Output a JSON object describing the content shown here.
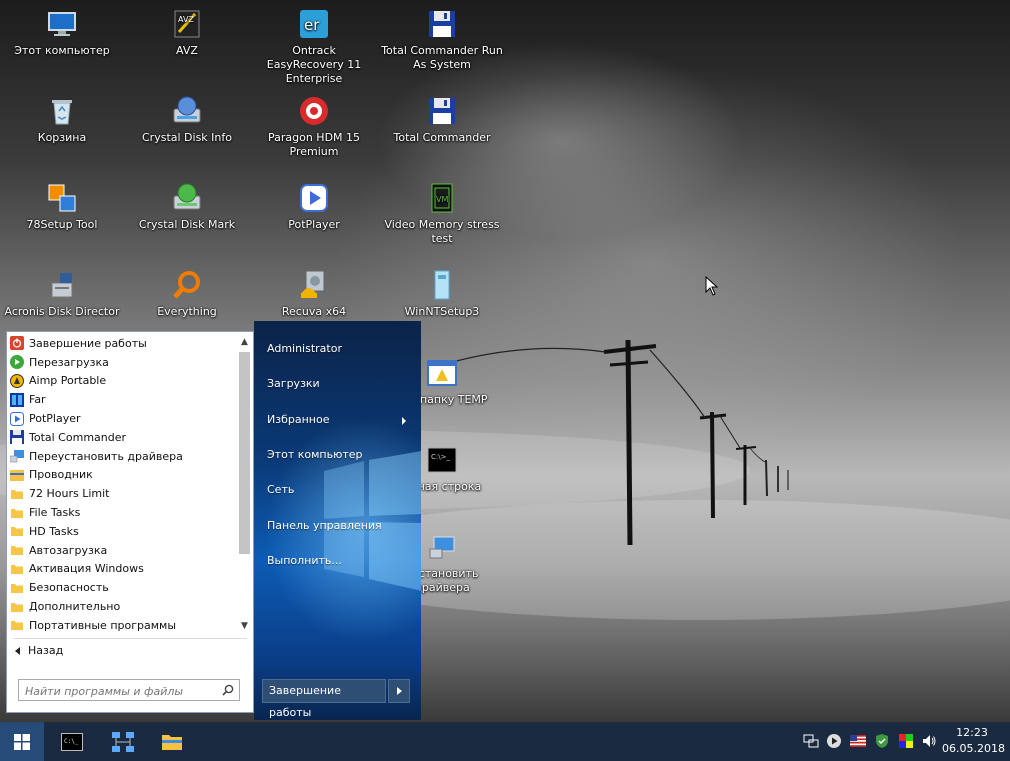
{
  "desktop": {
    "icons": [
      {
        "label": "Этот компьютер",
        "icon": "computer-icon"
      },
      {
        "label": "AVZ",
        "icon": "avz-icon"
      },
      {
        "label": "Ontrack EasyRecovery 11 Enterprise",
        "icon": "easyrecovery-icon"
      },
      {
        "label": "Total Commander Run As System",
        "icon": "floppy-icon"
      },
      {
        "label": "Корзина",
        "icon": "recycle-bin-icon"
      },
      {
        "label": "Crystal Disk Info",
        "icon": "crystal-disk-info-icon"
      },
      {
        "label": "Paragon HDM 15 Premium",
        "icon": "paragon-icon"
      },
      {
        "label": "Total Commander",
        "icon": "floppy-icon"
      },
      {
        "label": "78Setup Tool",
        "icon": "setup-tool-icon"
      },
      {
        "label": "Crystal Disk Mark",
        "icon": "crystal-disk-mark-icon"
      },
      {
        "label": "PotPlayer",
        "icon": "potplayer-icon"
      },
      {
        "label": "Video Memory stress test",
        "icon": "video-memory-icon"
      },
      {
        "label": "Acronis Disk Director",
        "icon": "acronis-icon"
      },
      {
        "label": "Everything",
        "icon": "search-icon"
      },
      {
        "label": "Recuva x64",
        "icon": "recuva-icon"
      },
      {
        "label": "WinNTSetup3",
        "icon": "winntsetup-icon"
      },
      {
        "label": "ить папку TEMP",
        "icon": "folder-cleanup-icon"
      },
      {
        "label": "ндная строка",
        "icon": "cmd-icon"
      },
      {
        "label": "еустановить драйвера",
        "icon": "driver-icon"
      }
    ]
  },
  "start_menu": {
    "programs": [
      {
        "label": "Завершение работы",
        "icon": "power-icon"
      },
      {
        "label": "Перезагрузка",
        "icon": "restart-icon"
      },
      {
        "label": "Aimp Portable",
        "icon": "aimp-icon"
      },
      {
        "label": "Far",
        "icon": "far-icon"
      },
      {
        "label": "PotPlayer",
        "icon": "potplayer-icon"
      },
      {
        "label": "Total Commander",
        "icon": "floppy-icon"
      },
      {
        "label": "Переустановить драйвера",
        "icon": "driver-icon"
      },
      {
        "label": "Проводник",
        "icon": "explorer-icon"
      },
      {
        "label": "72 Hours Limit",
        "icon": "folder-icon"
      },
      {
        "label": "File Tasks",
        "icon": "folder-icon"
      },
      {
        "label": "HD Tasks",
        "icon": "folder-icon"
      },
      {
        "label": "Автозагрузка",
        "icon": "folder-icon"
      },
      {
        "label": "Активация Windows",
        "icon": "folder-icon"
      },
      {
        "label": "Безопасность",
        "icon": "folder-icon"
      },
      {
        "label": "Дополнительно",
        "icon": "folder-icon"
      },
      {
        "label": "Портативные программы",
        "icon": "folder-icon"
      }
    ],
    "back_label": "Назад",
    "search_placeholder": "Найти программы и файлы",
    "right_items": [
      "Administrator",
      "Загрузки",
      "Избранное",
      "Этот компьютер",
      "Сеть",
      "Панель управления",
      "Выполнить..."
    ],
    "shutdown_label": "Завершение работы"
  },
  "taskbar": {
    "apps": [
      {
        "icon": "cmd-icon"
      },
      {
        "icon": "network-icon"
      },
      {
        "icon": "explorer-icon"
      }
    ],
    "tray": [
      "network-tray-icon",
      "media-play-icon",
      "us-flag-icon",
      "shield-icon",
      "color-icon",
      "volume-icon"
    ],
    "time": "12:23",
    "date": "06.05.2018"
  },
  "colors": {
    "accent": "#0d5cb5",
    "taskbar": "#1a2a40"
  }
}
